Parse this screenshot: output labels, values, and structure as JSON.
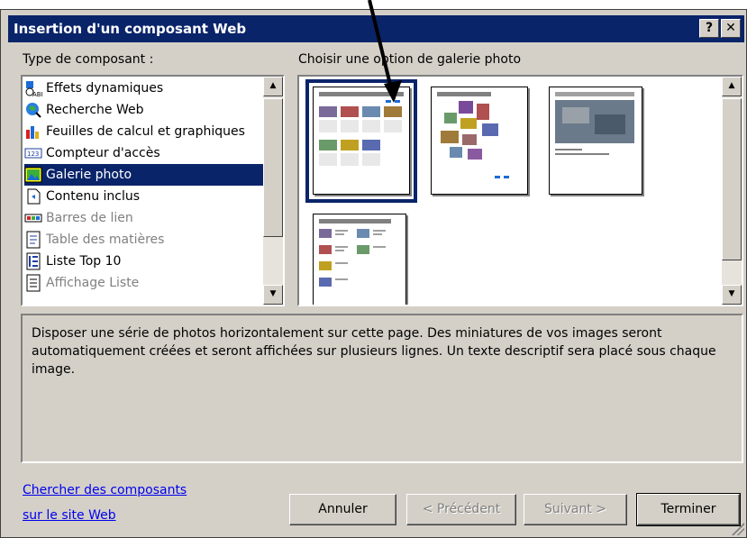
{
  "window": {
    "title": "Insertion d'un composant Web",
    "help_label": "?",
    "close_label": "✕"
  },
  "component_type": {
    "label": "Type de composant :",
    "items": [
      {
        "label": "Effets dynamiques",
        "icon": "dynamic-effects-icon",
        "state": "normal"
      },
      {
        "label": "Recherche Web",
        "icon": "web-search-icon",
        "state": "normal"
      },
      {
        "label": "Feuilles de calcul et graphiques",
        "icon": "spreadsheet-chart-icon",
        "state": "normal"
      },
      {
        "label": "Compteur d'accès",
        "icon": "hit-counter-icon",
        "state": "normal"
      },
      {
        "label": "Galerie photo",
        "icon": "photo-gallery-icon",
        "state": "selected"
      },
      {
        "label": "Contenu inclus",
        "icon": "included-content-icon",
        "state": "normal"
      },
      {
        "label": "Barres de lien",
        "icon": "link-bar-icon",
        "state": "disabled"
      },
      {
        "label": "Table des matières",
        "icon": "table-of-contents-icon",
        "state": "disabled"
      },
      {
        "label": "Liste Top 10",
        "icon": "top10-list-icon",
        "state": "normal"
      },
      {
        "label": "Affichage Liste",
        "icon": "list-view-icon",
        "state": "disabled"
      }
    ]
  },
  "gallery": {
    "label": "Choisir une option de galerie photo",
    "selected_index": 0
  },
  "description": "Disposer une série de photos horizontalement sur cette page. Des miniatures de vos images seront automatiquement créées et seront affichées sur plusieurs lignes. Un texte descriptif sera placé sous chaque image.",
  "link": {
    "line1": "Chercher des composants",
    "line2": "sur le site Web"
  },
  "buttons": {
    "cancel": "Annuler",
    "previous": "< Précédent",
    "next": "Suivant >",
    "finish": "Terminer"
  },
  "colors": {
    "titlebar": "#0a246a",
    "face": "#d4d0c8",
    "selection": "#0a246a",
    "link": "#0000ee"
  }
}
